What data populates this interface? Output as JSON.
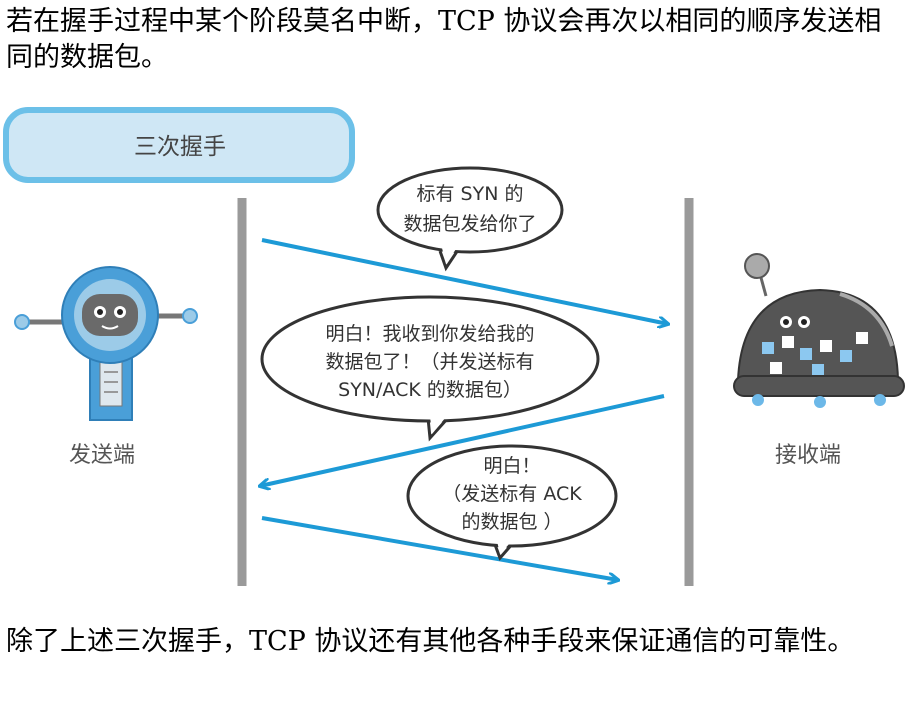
{
  "text": {
    "intro": "若在握手过程中某个阶段莫名中断，TCP 协议会再次以相同的顺序发送相同的数据包。",
    "outro": "除了上述三次握手，TCP 协议还有其他各种手段来保证通信的可靠性。"
  },
  "figure": {
    "title": "三次握手",
    "sender_label": "发送端",
    "receiver_label": "接收端",
    "bubble1": {
      "line1": "标有 SYN 的",
      "line2": "数据包发给你了"
    },
    "bubble2": {
      "line1": "明白！我收到你发给我的",
      "line2": "数据包了！（并发送标有",
      "line3": "SYN/ACK 的数据包）"
    },
    "bubble3": {
      "line1": "明白！",
      "line2": "（发送标有 ACK",
      "line3": "的数据包 ）"
    }
  },
  "colors": {
    "arrow": "#1d9ad6",
    "title_box_fill": "#cfe7f5",
    "title_box_border": "#6cc0e8",
    "divider": "#9a9a9a",
    "robot_blue": "#4a9fd8"
  },
  "icons": [
    "sender-robot-icon",
    "receiver-robot-icon"
  ]
}
